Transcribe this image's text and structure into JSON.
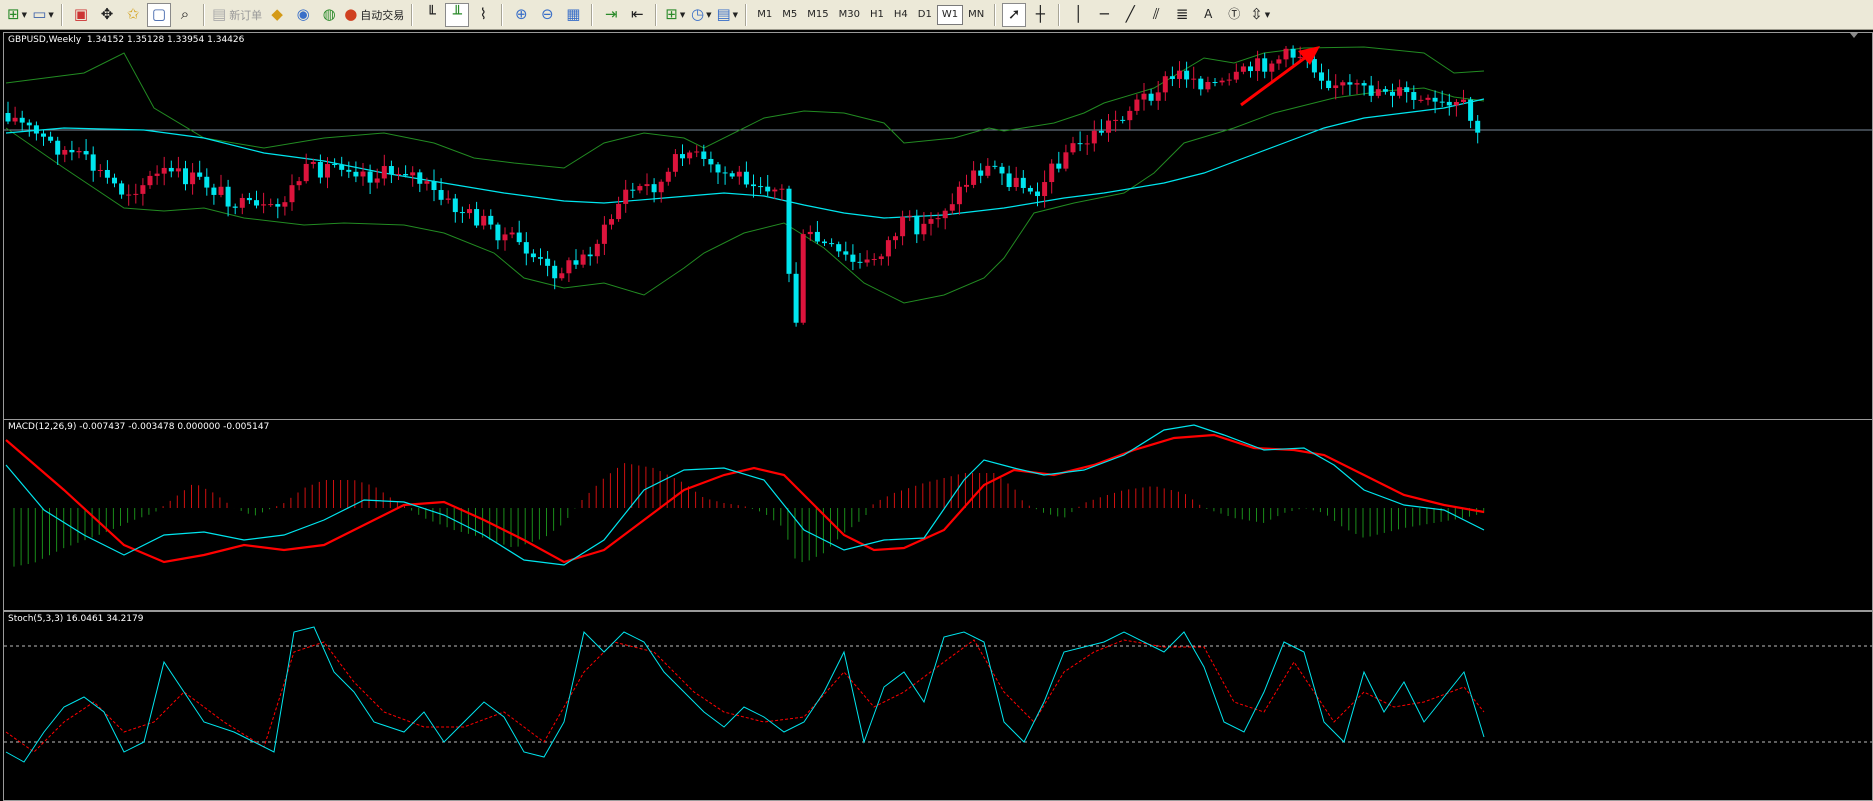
{
  "toolbar": {
    "new_order_label": "新订单",
    "autotrade_label": "自动交易",
    "timeframes": [
      "M1",
      "M5",
      "M15",
      "M30",
      "H1",
      "H4",
      "D1",
      "W1",
      "MN"
    ],
    "active_timeframe": "W1"
  },
  "main_chart": {
    "symbol": "GBPUSD,Weekly",
    "ohlc": "1.34152 1.35128 1.33954 1.34426"
  },
  "macd": {
    "label": "MACD(12,26,9) -0.007437 -0.003478 0.000000 -0.005147"
  },
  "stoch": {
    "label": "Stoch(5,3,3) 16.0461 34.2179"
  },
  "colors": {
    "bull": "#dc143c",
    "bear": "#00e5ee",
    "ma": "#00e5ee",
    "bands": "#228b22",
    "macd_main": "#ff0000",
    "macd_signal": "#00e5ee",
    "stoch_main": "#00e5ee",
    "stoch_signal": "#ff0000",
    "arrow": "#ff0000"
  }
}
